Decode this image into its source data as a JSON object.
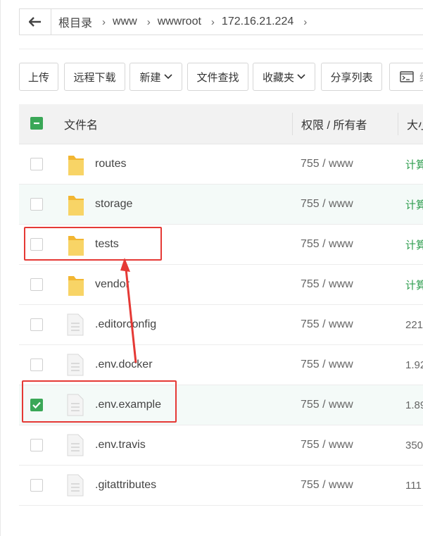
{
  "breadcrumb": {
    "items": [
      "根目录",
      "www",
      "wwwroot",
      "172.16.21.224"
    ]
  },
  "toolbar": {
    "upload": "上传",
    "remote_download": "远程下载",
    "new": "新建",
    "file_search": "文件查找",
    "favorites": "收藏夹",
    "share_list": "分享列表",
    "terminal_partial": "终"
  },
  "table": {
    "headers": {
      "name": "文件名",
      "perm": "权限 / 所有者",
      "size": "大小"
    },
    "rows": [
      {
        "name": "routes",
        "type": "folder",
        "perm": "755 / www",
        "size": "计算",
        "checked": false
      },
      {
        "name": "storage",
        "type": "folder",
        "perm": "755 / www",
        "size": "计算",
        "checked": false
      },
      {
        "name": "tests",
        "type": "folder",
        "perm": "755 / www",
        "size": "计算",
        "checked": false
      },
      {
        "name": "vendor",
        "type": "folder",
        "perm": "755 / www",
        "size": "计算",
        "checked": false
      },
      {
        "name": ".editorconfig",
        "type": "file",
        "perm": "755 / www",
        "size": "221",
        "checked": false
      },
      {
        "name": ".env.docker",
        "type": "file",
        "perm": "755 / www",
        "size": "1.92",
        "checked": false
      },
      {
        "name": ".env.example",
        "type": "file",
        "perm": "755 / www",
        "size": "1.89",
        "checked": true
      },
      {
        "name": ".env.travis",
        "type": "file",
        "perm": "755 / www",
        "size": "350",
        "checked": false
      },
      {
        "name": ".gitattributes",
        "type": "file",
        "perm": "755 / www",
        "size": "111",
        "checked": false
      }
    ]
  },
  "colors": {
    "accent_green": "#3aa757",
    "annotation_red": "#e53935",
    "folder_yellow": "#f5c542"
  }
}
